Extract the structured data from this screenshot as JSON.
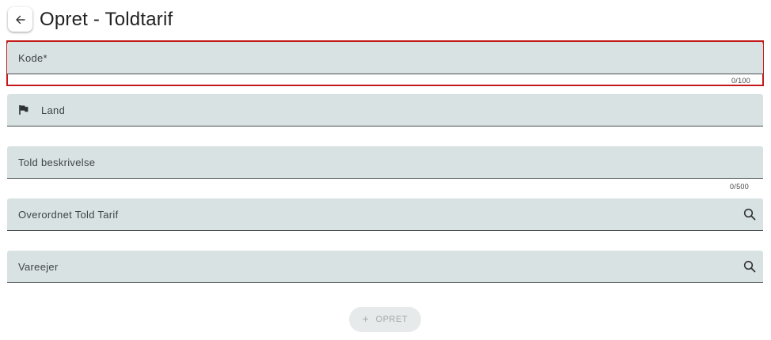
{
  "header": {
    "back_icon": "arrow-left-icon",
    "title": "Opret - Toldtarif"
  },
  "form": {
    "kode": {
      "label": "Kode*",
      "counter": "0/100",
      "error": true
    },
    "land": {
      "label": "Land",
      "icon": "flag-icon"
    },
    "beskrivelse": {
      "label": "Told beskrivelse",
      "counter": "0/500"
    },
    "overordnet": {
      "label": "Overordnet Told Tarif",
      "icon": "search-icon"
    },
    "vareejer": {
      "label": "Vareejer",
      "icon": "search-icon"
    }
  },
  "submit": {
    "icon": "plus-icon",
    "label": "OPRET",
    "disabled": true
  },
  "colors": {
    "field_bg": "#d9e2e2",
    "error": "#c41a1a",
    "disabled_text": "#a2a8a8"
  }
}
